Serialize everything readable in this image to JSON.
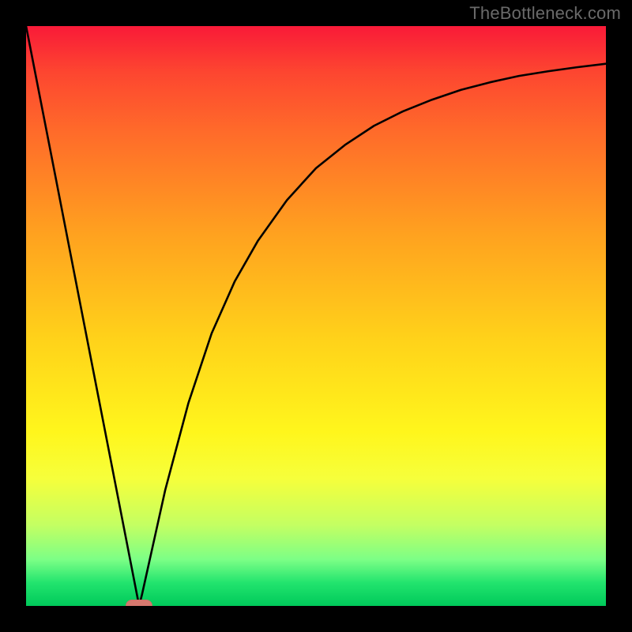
{
  "watermark": "TheBottleneck.com",
  "chart_data": {
    "type": "line",
    "title": "",
    "xlabel": "",
    "ylabel": "",
    "xlim": [
      0,
      100
    ],
    "ylim": [
      0,
      100
    ],
    "grid": false,
    "legend": false,
    "background": "red-yellow-green vertical gradient",
    "series": [
      {
        "name": "curve",
        "x": [
          0,
          5,
          10,
          15,
          19.5,
          20,
          22,
          24,
          28,
          32,
          36,
          40,
          45,
          50,
          55,
          60,
          65,
          70,
          75,
          80,
          85,
          90,
          95,
          100
        ],
        "y": [
          100,
          74.4,
          48.7,
          23.1,
          0,
          2,
          11,
          20,
          35,
          47,
          56,
          63,
          70,
          75.5,
          79.5,
          82.8,
          85.3,
          87.3,
          89,
          90.3,
          91.4,
          92.2,
          92.9,
          93.5
        ]
      }
    ],
    "marker": {
      "x": 19.5,
      "y": 0,
      "shape": "rounded-rect",
      "color": "#d6786e"
    }
  }
}
